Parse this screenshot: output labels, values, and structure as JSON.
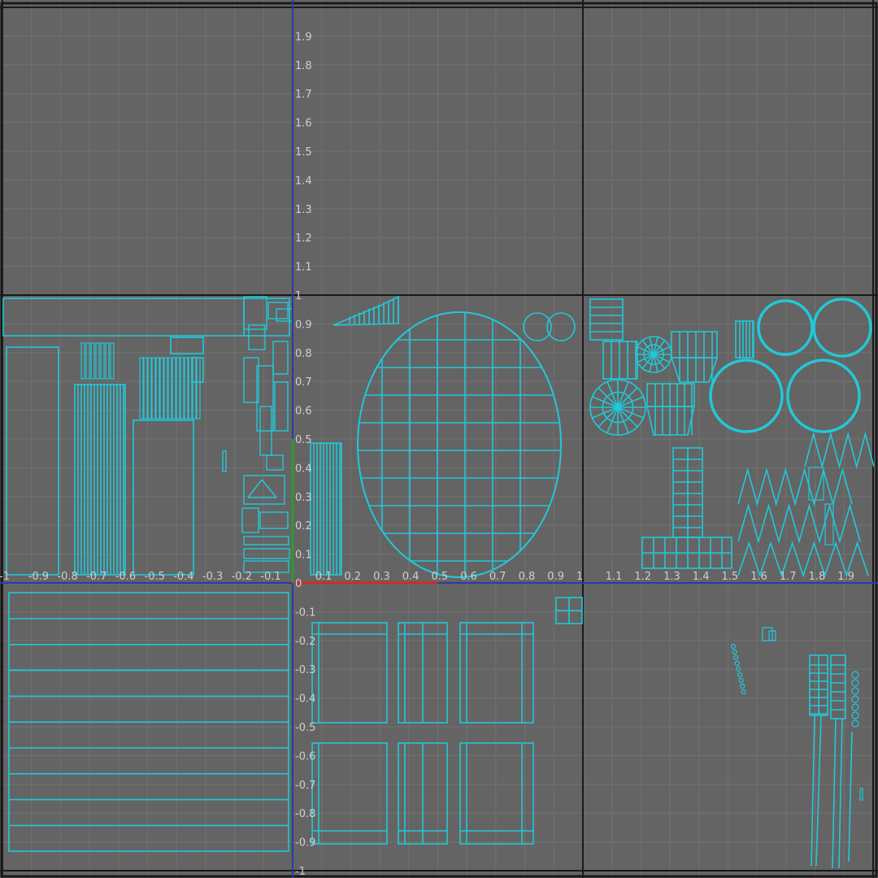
{
  "editor": {
    "view": "uv-texture-editor",
    "wireframe_color": "#21c8d8",
    "background_color": "#646464",
    "grid_color": "#727272",
    "tile_border_color": "#1a1a1a",
    "u_axis_color": "#cc2b2b",
    "v_axis_color": "#2a3aa8"
  },
  "axes": {
    "v_labels_positive": [
      "1.9",
      "1.8",
      "1.7",
      "1.6",
      "1.5",
      "1.4",
      "1.3",
      "1.2",
      "1.1",
      "1",
      "0.9",
      "0.8",
      "0.7",
      "0.6",
      "0.5",
      "0.4",
      "0.3",
      "0.2",
      "0.1",
      "0"
    ],
    "v_labels_negative": [
      "-0.1",
      "-0.2",
      "-0.3",
      "-0.4",
      "-0.5",
      "-0.6",
      "-0.7",
      "-0.8",
      "-0.9",
      "-1"
    ],
    "u_labels_negative": [
      "-1",
      "-0.9",
      "-0.8",
      "-0.7",
      "-0.6",
      "-0.5",
      "-0.4",
      "-0.3",
      "-0.2",
      "-0.1"
    ],
    "u_labels_positive": [
      "0.1",
      "0.2",
      "0.3",
      "0.4",
      "0.5",
      "0.6",
      "0.7",
      "0.8",
      "0.9",
      "1",
      "1.1",
      "1.2",
      "1.3",
      "1.4",
      "1.5",
      "1.6",
      "1.7",
      "1.8",
      "1.9"
    ]
  },
  "uv_shells": [
    "long-plank-strip",
    "tall-plank-cluster",
    "vertical-bar-bundle",
    "small-fragment-cluster",
    "wedge-strip",
    "center-bar-bundle",
    "large-grid-disc",
    "twin-rings",
    "box-cluster",
    "radial-discs",
    "torus-rings",
    "t-shaped-grid",
    "zigzag-strips",
    "striped-panel",
    "panel-boxes",
    "small-grid-square",
    "ladder-strips",
    "scattered-fragments"
  ]
}
